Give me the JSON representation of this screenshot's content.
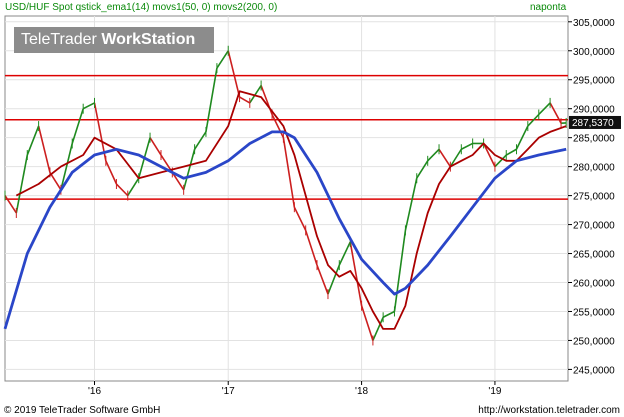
{
  "header": {
    "instrument": "USD/HUF Spot",
    "indicators": "qstick_ema1(14) movs1(50, 0) movs2(200, 0)",
    "period": "naponta"
  },
  "watermark": {
    "brand": "TeleTrader",
    "product": "WorkStation"
  },
  "footer": {
    "copyright": "© 2019 TeleTrader Software GmbH",
    "url": "http://workstation.teletrader.com"
  },
  "colors": {
    "price_up": "#1f8a1f",
    "price_down": "#cc1f1f",
    "ma50": "#aa0000",
    "ma200": "#2a46c8",
    "hline": "#dd0000",
    "header_text": "#0a8a0a",
    "last_price_bg": "#111111"
  },
  "chart_data": {
    "type": "line",
    "y_axis": {
      "position": "right",
      "range": [
        243,
        306
      ],
      "ticks": [
        245,
        250,
        255,
        260,
        265,
        270,
        275,
        280,
        285,
        290,
        295,
        300,
        305
      ],
      "tick_labels": [
        "245,0000",
        "250,0000",
        "255,0000",
        "260,0000",
        "265,0000",
        "270,0000",
        "275,0000",
        "280,0000",
        "285,0000",
        "290,0000",
        "295,0000",
        "300,0000",
        "305,0000"
      ]
    },
    "x_axis": {
      "range": [
        "2015-05-01",
        "2019-07-20"
      ],
      "ticks": [
        "2016-01-01",
        "2017-01-01",
        "2018-01-01",
        "2019-01-01"
      ],
      "tick_labels": [
        "'16",
        "'17",
        "'18",
        "'19"
      ]
    },
    "grid": true,
    "last_price": {
      "value": 287.537,
      "label": "287,5370"
    },
    "horizontal_lines": [
      295.7,
      288.1,
      274.4
    ],
    "series": [
      {
        "id": "price",
        "points": [
          [
            "2015-05-01",
            275
          ],
          [
            "2015-06-01",
            272
          ],
          [
            "2015-07-01",
            282
          ],
          [
            "2015-08-01",
            287
          ],
          [
            "2015-09-01",
            279
          ],
          [
            "2015-10-01",
            276
          ],
          [
            "2015-11-01",
            284
          ],
          [
            "2015-12-01",
            290
          ],
          [
            "2016-01-01",
            291
          ],
          [
            "2016-02-01",
            281
          ],
          [
            "2016-03-01",
            277
          ],
          [
            "2016-04-01",
            275
          ],
          [
            "2016-05-01",
            278
          ],
          [
            "2016-06-01",
            285
          ],
          [
            "2016-07-01",
            282
          ],
          [
            "2016-08-01",
            279
          ],
          [
            "2016-09-01",
            276
          ],
          [
            "2016-10-01",
            283
          ],
          [
            "2016-11-01",
            286
          ],
          [
            "2016-12-01",
            297
          ],
          [
            "2017-01-01",
            300
          ],
          [
            "2017-02-01",
            292
          ],
          [
            "2017-03-01",
            291
          ],
          [
            "2017-04-01",
            294
          ],
          [
            "2017-05-01",
            289
          ],
          [
            "2017-06-01",
            285
          ],
          [
            "2017-07-01",
            273
          ],
          [
            "2017-08-01",
            269
          ],
          [
            "2017-09-01",
            263
          ],
          [
            "2017-10-01",
            258
          ],
          [
            "2017-11-01",
            263
          ],
          [
            "2017-12-01",
            267
          ],
          [
            "2018-01-01",
            256
          ],
          [
            "2018-02-01",
            250
          ],
          [
            "2018-03-01",
            254
          ],
          [
            "2018-04-01",
            255
          ],
          [
            "2018-05-01",
            269
          ],
          [
            "2018-06-01",
            278
          ],
          [
            "2018-07-01",
            281
          ],
          [
            "2018-08-01",
            283
          ],
          [
            "2018-09-01",
            280
          ],
          [
            "2018-10-01",
            283
          ],
          [
            "2018-11-01",
            284
          ],
          [
            "2018-12-01",
            284
          ],
          [
            "2019-01-01",
            280
          ],
          [
            "2019-02-01",
            282
          ],
          [
            "2019-03-01",
            283
          ],
          [
            "2019-04-01",
            287
          ],
          [
            "2019-05-01",
            289
          ],
          [
            "2019-06-01",
            291
          ],
          [
            "2019-07-01",
            287.5
          ],
          [
            "2019-07-15",
            287.537
          ]
        ]
      },
      {
        "id": "ma50",
        "points": [
          [
            "2015-06-01",
            275
          ],
          [
            "2015-08-01",
            277
          ],
          [
            "2015-10-01",
            280
          ],
          [
            "2015-12-01",
            282
          ],
          [
            "2016-01-01",
            285
          ],
          [
            "2016-03-01",
            283
          ],
          [
            "2016-05-01",
            278
          ],
          [
            "2016-07-01",
            279
          ],
          [
            "2016-09-01",
            280
          ],
          [
            "2016-11-01",
            281
          ],
          [
            "2017-01-01",
            287
          ],
          [
            "2017-02-01",
            293
          ],
          [
            "2017-04-01",
            292
          ],
          [
            "2017-06-01",
            287
          ],
          [
            "2017-07-01",
            282
          ],
          [
            "2017-08-01",
            275
          ],
          [
            "2017-09-01",
            268
          ],
          [
            "2017-10-01",
            263
          ],
          [
            "2017-11-01",
            261
          ],
          [
            "2017-12-01",
            262
          ],
          [
            "2018-01-01",
            259
          ],
          [
            "2018-02-01",
            255
          ],
          [
            "2018-03-01",
            252
          ],
          [
            "2018-04-01",
            252
          ],
          [
            "2018-05-01",
            256
          ],
          [
            "2018-06-01",
            265
          ],
          [
            "2018-07-01",
            272
          ],
          [
            "2018-08-01",
            277
          ],
          [
            "2018-09-01",
            280
          ],
          [
            "2018-10-01",
            281
          ],
          [
            "2018-11-01",
            282
          ],
          [
            "2018-12-01",
            284
          ],
          [
            "2019-01-01",
            282
          ],
          [
            "2019-02-01",
            281
          ],
          [
            "2019-03-01",
            281
          ],
          [
            "2019-04-01",
            283
          ],
          [
            "2019-05-01",
            285
          ],
          [
            "2019-06-01",
            286
          ],
          [
            "2019-07-15",
            287
          ]
        ]
      },
      {
        "id": "ma200",
        "points": [
          [
            "2015-05-01",
            252
          ],
          [
            "2015-07-01",
            265
          ],
          [
            "2015-09-01",
            273
          ],
          [
            "2015-11-01",
            279
          ],
          [
            "2016-01-01",
            282
          ],
          [
            "2016-03-01",
            283
          ],
          [
            "2016-05-01",
            282
          ],
          [
            "2016-07-01",
            280
          ],
          [
            "2016-09-01",
            278
          ],
          [
            "2016-11-01",
            279
          ],
          [
            "2017-01-01",
            281
          ],
          [
            "2017-03-01",
            284
          ],
          [
            "2017-05-01",
            286
          ],
          [
            "2017-06-01",
            286
          ],
          [
            "2017-07-01",
            285
          ],
          [
            "2017-09-01",
            279
          ],
          [
            "2017-11-01",
            271
          ],
          [
            "2018-01-01",
            264
          ],
          [
            "2018-03-01",
            260
          ],
          [
            "2018-04-01",
            258
          ],
          [
            "2018-05-01",
            259
          ],
          [
            "2018-07-01",
            263
          ],
          [
            "2018-09-01",
            268
          ],
          [
            "2018-11-01",
            273
          ],
          [
            "2019-01-01",
            278
          ],
          [
            "2019-03-01",
            281
          ],
          [
            "2019-05-01",
            282
          ],
          [
            "2019-07-15",
            283
          ]
        ]
      }
    ]
  }
}
